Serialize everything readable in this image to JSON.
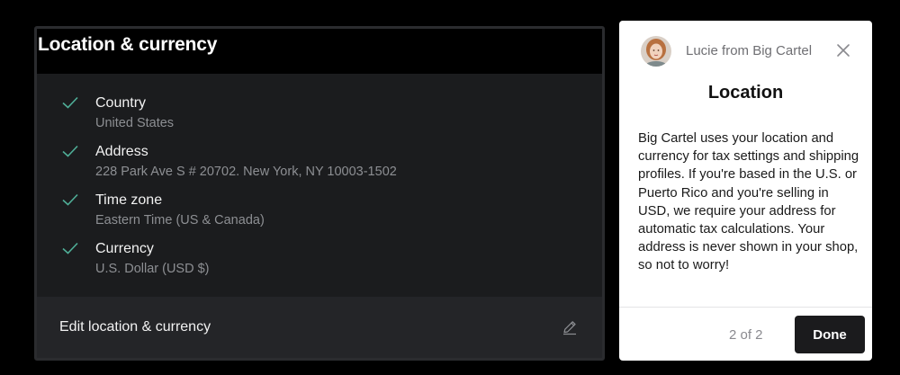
{
  "panel": {
    "title": "Location & currency",
    "items": [
      {
        "label": "Country",
        "value": "United States",
        "icon": "check-icon"
      },
      {
        "label": "Address",
        "value": "228 Park Ave S # 20702. New York, NY 10003-1502",
        "icon": "check-icon"
      },
      {
        "label": "Time zone",
        "value": "Eastern Time (US & Canada)",
        "icon": "check-icon"
      },
      {
        "label": "Currency",
        "value": "U.S. Dollar (USD $)",
        "icon": "check-icon"
      }
    ],
    "footer_label": "Edit location & currency",
    "edit_icon": "pencil-icon"
  },
  "tooltip": {
    "from": "Lucie from Big Cartel",
    "title": "Location",
    "body": "Big Cartel uses your location and currency for tax settings and shipping profiles. If you're based in the U.S. or Puerto Rico and you're selling in USD, we require your address for automatic tax calculations. Your address is never shown in your shop, so not to worry!",
    "step": "2 of 2",
    "done_label": "Done",
    "close_icon": "close-icon"
  },
  "colors": {
    "check": "#4fae97",
    "panel_bg": "#1b1c1e",
    "footer_bg": "#242528",
    "done_bg": "#1b1b1d"
  }
}
